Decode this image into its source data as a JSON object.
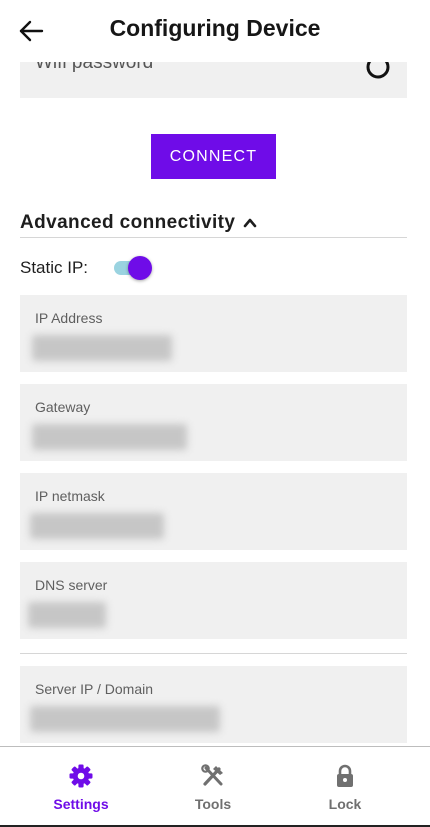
{
  "header": {
    "title": "Configuring Device"
  },
  "wifi": {
    "password_placeholder": "Wifi password"
  },
  "connect": {
    "label": "CONNECT"
  },
  "advanced": {
    "title": "Advanced connectivity",
    "expanded": true
  },
  "static_ip": {
    "label": "Static IP:",
    "enabled": true
  },
  "fields": [
    {
      "label": "IP Address"
    },
    {
      "label": "Gateway"
    },
    {
      "label": "IP netmask"
    },
    {
      "label": "DNS server"
    },
    {
      "label": "Server IP / Domain"
    }
  ],
  "nav": {
    "items": [
      {
        "label": "Settings",
        "icon": "gear-icon",
        "active": true
      },
      {
        "label": "Tools",
        "icon": "tools-icon",
        "active": false
      },
      {
        "label": "Lock",
        "icon": "lock-icon",
        "active": false
      }
    ]
  },
  "colors": {
    "accent": "#6f0ce8",
    "toggle_track": "#9ad3e0",
    "field_bg": "#f0f0f0",
    "nav_inactive": "#707070"
  }
}
